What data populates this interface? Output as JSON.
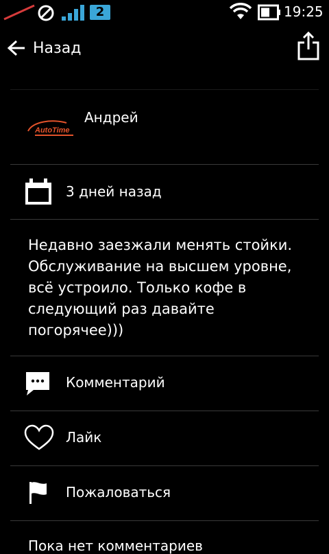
{
  "status_bar": {
    "sim_number": "2",
    "time": "19:25"
  },
  "header": {
    "back_label": "Назад",
    "share_icon": "share-icon"
  },
  "review": {
    "author_name": "Андрей",
    "logo_text": "AutoTime",
    "date": "3 дней назад",
    "text": "Недавно заезжали менять стойки. Обслуживание на высшем уровне, всё устроило. Только кофе в следующий раз давайте погорячее)))"
  },
  "actions": {
    "comment_label": "Комментарий",
    "like_label": "Лайк",
    "report_label": "Пожаловаться"
  },
  "comments": {
    "empty_text": "Пока нет комментариев"
  },
  "colors": {
    "accent_blue": "#3aa6d8",
    "logo_red": "#e4532b",
    "no_signal_red": "#d63b3b"
  }
}
